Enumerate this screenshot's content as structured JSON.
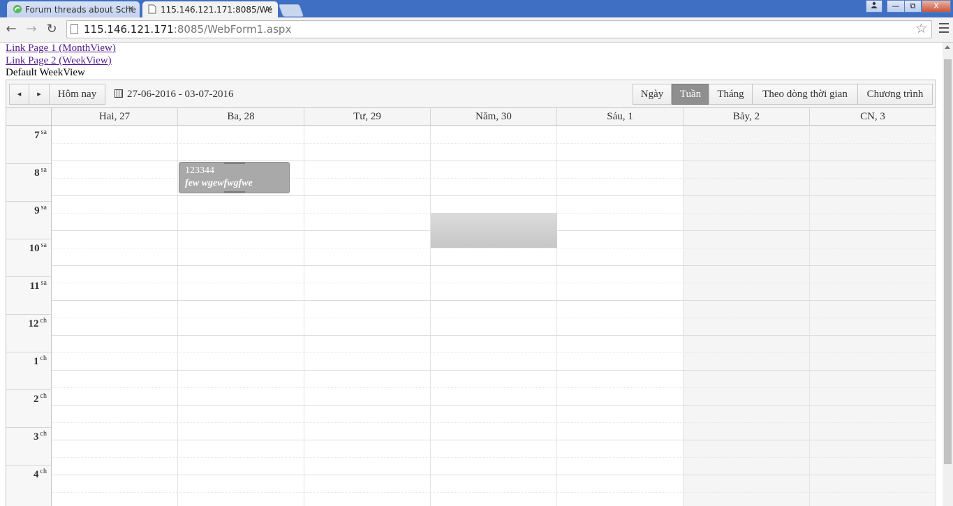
{
  "browser": {
    "tabs": [
      {
        "title": "Forum threads about Sche",
        "active": false
      },
      {
        "title": "115.146.121.171:8085/We",
        "active": true
      }
    ],
    "url_host": "115.146.121.171",
    "url_rest": ":8085/WebForm1.aspx",
    "window_buttons": {
      "user": "▲",
      "minimize": "—",
      "restore": "⧉",
      "close": "X"
    }
  },
  "page": {
    "link1": "Link Page 1 (MonthView)",
    "link2": "Link Page 2 (WeekView)",
    "heading": "Default WeekView"
  },
  "scheduler": {
    "prev": "◂",
    "next": "▸",
    "today": "Hôm nay",
    "date_range": "27-06-2016 - 03-07-2016",
    "views": [
      "Ngày",
      "Tuần",
      "Tháng",
      "Theo dòng thời gian",
      "Chương trình"
    ],
    "selected_view": "Tuần",
    "days": [
      "Hai, 27",
      "Ba, 28",
      "Tư, 29",
      "Năm, 30",
      "Sáu, 1",
      "Bảy, 2",
      "CN, 3"
    ],
    "weekend_days": [
      "Bảy, 2",
      "CN, 3"
    ],
    "times": [
      {
        "hour": "7",
        "suffix": "sa"
      },
      {
        "hour": "8",
        "suffix": "sa"
      },
      {
        "hour": "9",
        "suffix": "sa"
      },
      {
        "hour": "10",
        "suffix": "sa"
      },
      {
        "hour": "11",
        "suffix": "sa"
      },
      {
        "hour": "12",
        "suffix": "ch"
      },
      {
        "hour": "1",
        "suffix": "ch"
      },
      {
        "hour": "2",
        "suffix": "ch"
      },
      {
        "hour": "3",
        "suffix": "ch"
      },
      {
        "hour": "4",
        "suffix": "ch"
      }
    ],
    "event": {
      "title": "123344",
      "description": "few wgewfwgfwe",
      "day": "Ba, 28",
      "color": "#a9a9a9"
    },
    "selected_slot": {
      "day": "Năm, 30"
    }
  }
}
